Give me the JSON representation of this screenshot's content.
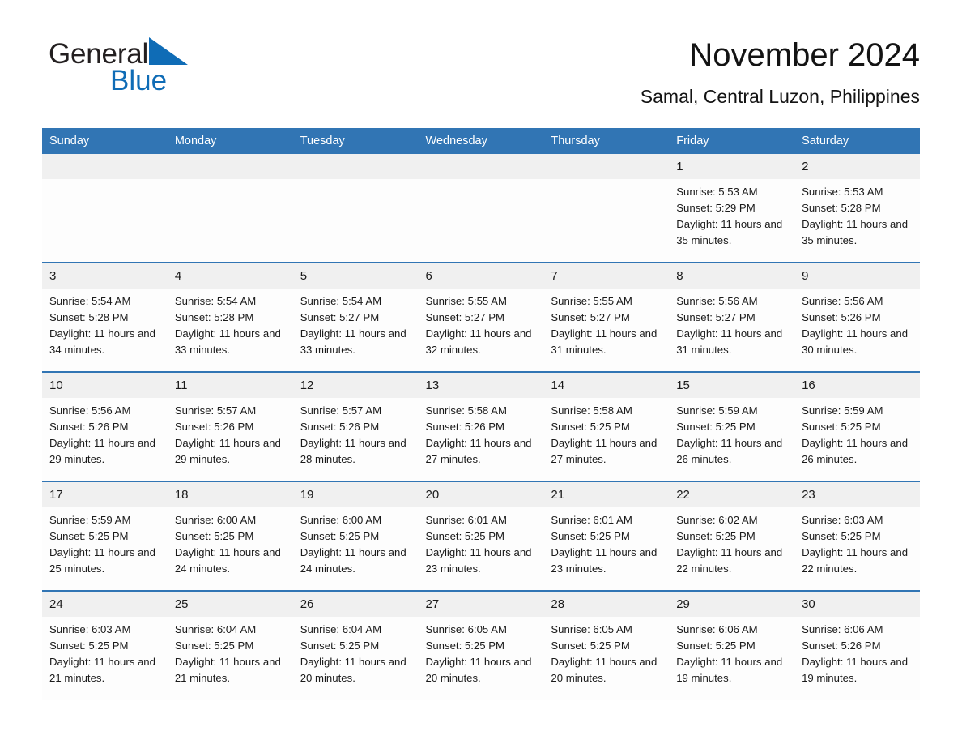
{
  "brand": {
    "word1": "General",
    "word2": "Blue",
    "triangle_color": "#0f6cb6",
    "icon": "triangle-logo-icon"
  },
  "header": {
    "title": "November 2024",
    "subtitle": "Samal, Central Luzon, Philippines"
  },
  "theme": {
    "header_blue": "#3175b4",
    "daynum_gray": "#f0f0f0",
    "cell_white": "#fdfdfd"
  },
  "weekday_headers": [
    "Sunday",
    "Monday",
    "Tuesday",
    "Wednesday",
    "Thursday",
    "Friday",
    "Saturday"
  ],
  "weeks": [
    [
      {
        "day": "",
        "sunrise": "",
        "sunset": "",
        "daylight": ""
      },
      {
        "day": "",
        "sunrise": "",
        "sunset": "",
        "daylight": ""
      },
      {
        "day": "",
        "sunrise": "",
        "sunset": "",
        "daylight": ""
      },
      {
        "day": "",
        "sunrise": "",
        "sunset": "",
        "daylight": ""
      },
      {
        "day": "",
        "sunrise": "",
        "sunset": "",
        "daylight": ""
      },
      {
        "day": "1",
        "sunrise": "Sunrise: 5:53 AM",
        "sunset": "Sunset: 5:29 PM",
        "daylight": "Daylight: 11 hours and 35 minutes."
      },
      {
        "day": "2",
        "sunrise": "Sunrise: 5:53 AM",
        "sunset": "Sunset: 5:28 PM",
        "daylight": "Daylight: 11 hours and 35 minutes."
      }
    ],
    [
      {
        "day": "3",
        "sunrise": "Sunrise: 5:54 AM",
        "sunset": "Sunset: 5:28 PM",
        "daylight": "Daylight: 11 hours and 34 minutes."
      },
      {
        "day": "4",
        "sunrise": "Sunrise: 5:54 AM",
        "sunset": "Sunset: 5:28 PM",
        "daylight": "Daylight: 11 hours and 33 minutes."
      },
      {
        "day": "5",
        "sunrise": "Sunrise: 5:54 AM",
        "sunset": "Sunset: 5:27 PM",
        "daylight": "Daylight: 11 hours and 33 minutes."
      },
      {
        "day": "6",
        "sunrise": "Sunrise: 5:55 AM",
        "sunset": "Sunset: 5:27 PM",
        "daylight": "Daylight: 11 hours and 32 minutes."
      },
      {
        "day": "7",
        "sunrise": "Sunrise: 5:55 AM",
        "sunset": "Sunset: 5:27 PM",
        "daylight": "Daylight: 11 hours and 31 minutes."
      },
      {
        "day": "8",
        "sunrise": "Sunrise: 5:56 AM",
        "sunset": "Sunset: 5:27 PM",
        "daylight": "Daylight: 11 hours and 31 minutes."
      },
      {
        "day": "9",
        "sunrise": "Sunrise: 5:56 AM",
        "sunset": "Sunset: 5:26 PM",
        "daylight": "Daylight: 11 hours and 30 minutes."
      }
    ],
    [
      {
        "day": "10",
        "sunrise": "Sunrise: 5:56 AM",
        "sunset": "Sunset: 5:26 PM",
        "daylight": "Daylight: 11 hours and 29 minutes."
      },
      {
        "day": "11",
        "sunrise": "Sunrise: 5:57 AM",
        "sunset": "Sunset: 5:26 PM",
        "daylight": "Daylight: 11 hours and 29 minutes."
      },
      {
        "day": "12",
        "sunrise": "Sunrise: 5:57 AM",
        "sunset": "Sunset: 5:26 PM",
        "daylight": "Daylight: 11 hours and 28 minutes."
      },
      {
        "day": "13",
        "sunrise": "Sunrise: 5:58 AM",
        "sunset": "Sunset: 5:26 PM",
        "daylight": "Daylight: 11 hours and 27 minutes."
      },
      {
        "day": "14",
        "sunrise": "Sunrise: 5:58 AM",
        "sunset": "Sunset: 5:25 PM",
        "daylight": "Daylight: 11 hours and 27 minutes."
      },
      {
        "day": "15",
        "sunrise": "Sunrise: 5:59 AM",
        "sunset": "Sunset: 5:25 PM",
        "daylight": "Daylight: 11 hours and 26 minutes."
      },
      {
        "day": "16",
        "sunrise": "Sunrise: 5:59 AM",
        "sunset": "Sunset: 5:25 PM",
        "daylight": "Daylight: 11 hours and 26 minutes."
      }
    ],
    [
      {
        "day": "17",
        "sunrise": "Sunrise: 5:59 AM",
        "sunset": "Sunset: 5:25 PM",
        "daylight": "Daylight: 11 hours and 25 minutes."
      },
      {
        "day": "18",
        "sunrise": "Sunrise: 6:00 AM",
        "sunset": "Sunset: 5:25 PM",
        "daylight": "Daylight: 11 hours and 24 minutes."
      },
      {
        "day": "19",
        "sunrise": "Sunrise: 6:00 AM",
        "sunset": "Sunset: 5:25 PM",
        "daylight": "Daylight: 11 hours and 24 minutes."
      },
      {
        "day": "20",
        "sunrise": "Sunrise: 6:01 AM",
        "sunset": "Sunset: 5:25 PM",
        "daylight": "Daylight: 11 hours and 23 minutes."
      },
      {
        "day": "21",
        "sunrise": "Sunrise: 6:01 AM",
        "sunset": "Sunset: 5:25 PM",
        "daylight": "Daylight: 11 hours and 23 minutes."
      },
      {
        "day": "22",
        "sunrise": "Sunrise: 6:02 AM",
        "sunset": "Sunset: 5:25 PM",
        "daylight": "Daylight: 11 hours and 22 minutes."
      },
      {
        "day": "23",
        "sunrise": "Sunrise: 6:03 AM",
        "sunset": "Sunset: 5:25 PM",
        "daylight": "Daylight: 11 hours and 22 minutes."
      }
    ],
    [
      {
        "day": "24",
        "sunrise": "Sunrise: 6:03 AM",
        "sunset": "Sunset: 5:25 PM",
        "daylight": "Daylight: 11 hours and 21 minutes."
      },
      {
        "day": "25",
        "sunrise": "Sunrise: 6:04 AM",
        "sunset": "Sunset: 5:25 PM",
        "daylight": "Daylight: 11 hours and 21 minutes."
      },
      {
        "day": "26",
        "sunrise": "Sunrise: 6:04 AM",
        "sunset": "Sunset: 5:25 PM",
        "daylight": "Daylight: 11 hours and 20 minutes."
      },
      {
        "day": "27",
        "sunrise": "Sunrise: 6:05 AM",
        "sunset": "Sunset: 5:25 PM",
        "daylight": "Daylight: 11 hours and 20 minutes."
      },
      {
        "day": "28",
        "sunrise": "Sunrise: 6:05 AM",
        "sunset": "Sunset: 5:25 PM",
        "daylight": "Daylight: 11 hours and 20 minutes."
      },
      {
        "day": "29",
        "sunrise": "Sunrise: 6:06 AM",
        "sunset": "Sunset: 5:25 PM",
        "daylight": "Daylight: 11 hours and 19 minutes."
      },
      {
        "day": "30",
        "sunrise": "Sunrise: 6:06 AM",
        "sunset": "Sunset: 5:26 PM",
        "daylight": "Daylight: 11 hours and 19 minutes."
      }
    ]
  ]
}
